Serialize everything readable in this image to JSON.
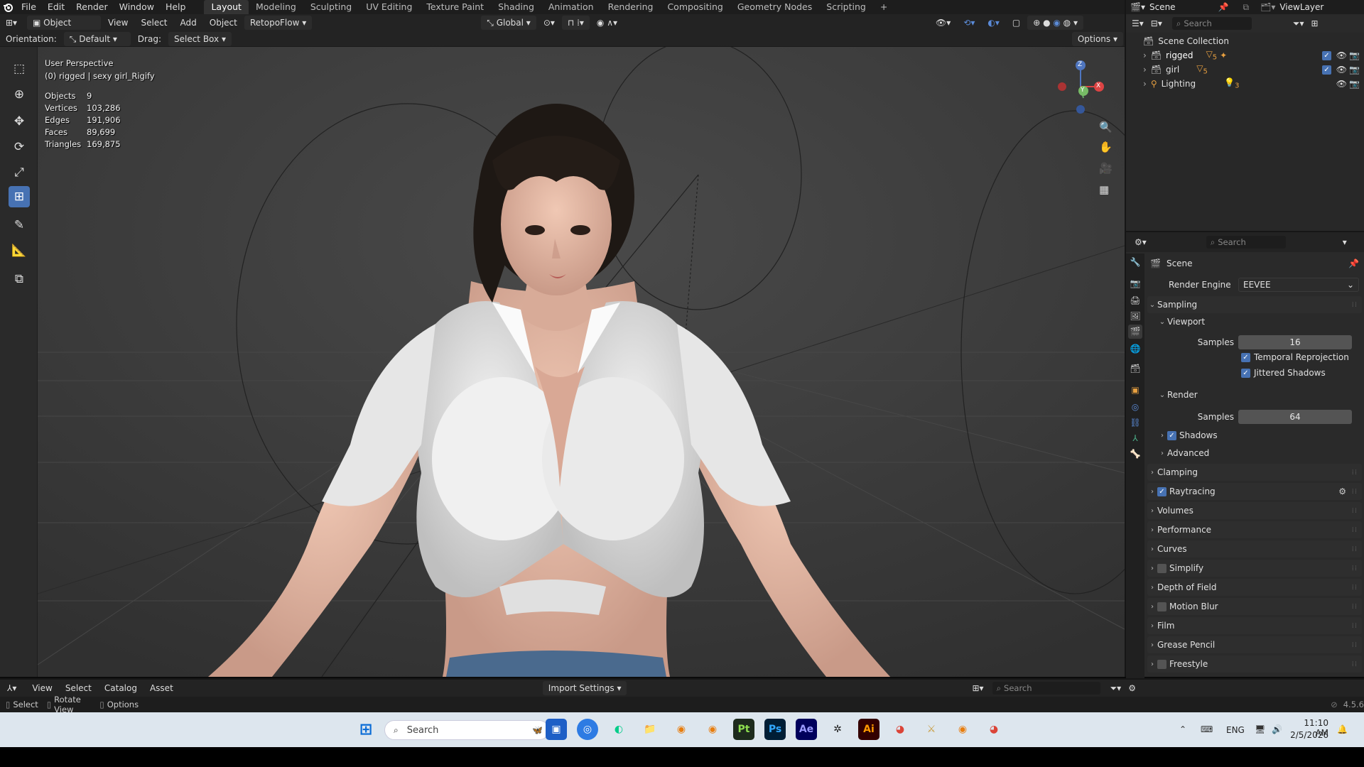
{
  "menu": [
    "File",
    "Edit",
    "Render",
    "Window",
    "Help"
  ],
  "workspaces": [
    "Layout",
    "Modeling",
    "Sculpting",
    "UV Editing",
    "Texture Paint",
    "Shading",
    "Animation",
    "Rendering",
    "Compositing",
    "Geometry Nodes",
    "Scripting"
  ],
  "active_workspace": "Layout",
  "scene_name": "Scene",
  "view_layer": "ViewLayer",
  "header": {
    "mode": "Object Mode",
    "items": [
      "View",
      "Select",
      "Add",
      "Object"
    ],
    "addon": "RetopoFlow",
    "transform": "Global",
    "options": "Options"
  },
  "tool_settings": {
    "orientation_label": "Orientation:",
    "orientation": "Default",
    "drag_label": "Drag:",
    "drag": "Select Box"
  },
  "viewport": {
    "perspective": "User Perspective",
    "active_object": "(0) rigged | sexy girl_Rigify",
    "stats": [
      {
        "label": "Objects",
        "value": "9"
      },
      {
        "label": "Vertices",
        "value": "103,286"
      },
      {
        "label": "Edges",
        "value": "191,906"
      },
      {
        "label": "Faces",
        "value": "89,699"
      },
      {
        "label": "Triangles",
        "value": "169,875"
      }
    ],
    "axes": {
      "z": "Z",
      "x": "X",
      "y": "Y"
    }
  },
  "outliner": {
    "search_placeholder": "Search",
    "collection": "Scene Collection",
    "items": [
      {
        "name": "rigged",
        "badge": "5"
      },
      {
        "name": "girl",
        "badge": "5"
      },
      {
        "name": "Lighting",
        "badge": "3"
      }
    ]
  },
  "properties": {
    "search_placeholder": "Search",
    "context": "Scene",
    "render_engine_label": "Render Engine",
    "render_engine": "EEVEE",
    "sampling": "Sampling",
    "viewport_label": "Viewport",
    "viewport_samples_label": "Samples",
    "viewport_samples": "16",
    "temporal_reprojection": "Temporal Reprojection",
    "jittered_shadows": "Jittered Shadows",
    "render_label": "Render",
    "render_samples_label": "Samples",
    "render_samples": "64",
    "shadows": "Shadows",
    "advanced": "Advanced",
    "panels": [
      "Clamping",
      "Raytracing",
      "Volumes",
      "Performance",
      "Curves",
      "Simplify",
      "Depth of Field",
      "Motion Blur",
      "Film",
      "Grease Pencil",
      "Freestyle"
    ]
  },
  "asset_bar": {
    "items": [
      "View",
      "Select",
      "Catalog",
      "Asset"
    ],
    "import": "Import Settings",
    "search_placeholder": "Search"
  },
  "status_bar": {
    "items": [
      "Select",
      "Rotate View",
      "Options"
    ],
    "version": "4.5.6"
  },
  "taskbar": {
    "search": "Search",
    "lang": "ENG",
    "time": "11:10 AM",
    "date": "2/5/2026"
  }
}
